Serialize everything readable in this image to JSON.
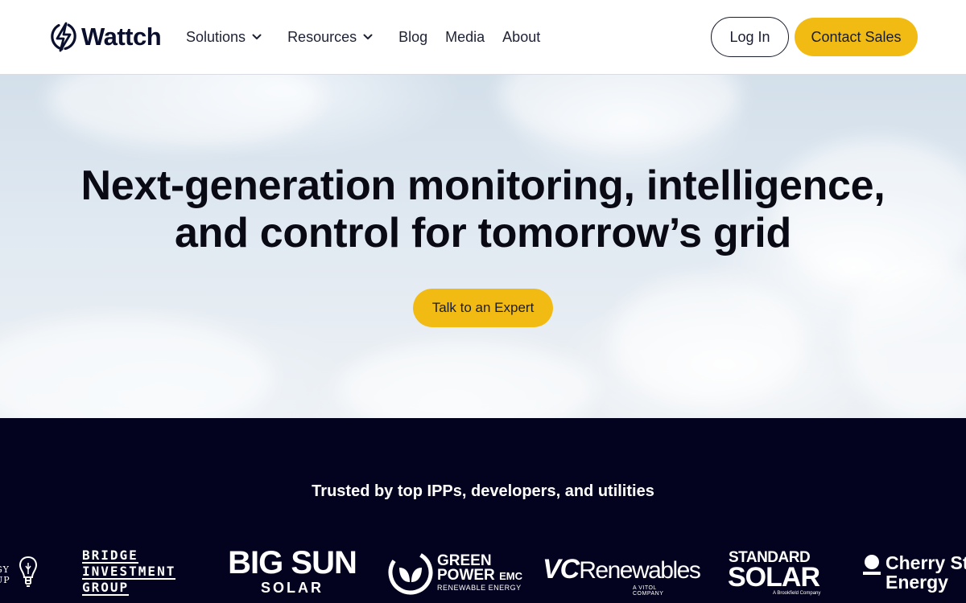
{
  "nav": {
    "brand": "Wattch",
    "items": [
      {
        "label": "Solutions",
        "has_dropdown": true
      },
      {
        "label": "Resources",
        "has_dropdown": true
      },
      {
        "label": "Blog"
      },
      {
        "label": "Media"
      },
      {
        "label": "About"
      }
    ],
    "login_label": "Log In",
    "contact_label": "Contact Sales"
  },
  "hero": {
    "title_line1": "Next-generation monitoring, intelligence,",
    "title_line2": "and control for tomorrow’s grid",
    "cta_label": "Talk to an Expert"
  },
  "trust": {
    "title": "Trusted by top IPPs, developers, and utilities",
    "logos": {
      "energy_group": {
        "line1": "GY",
        "line2": "UP"
      },
      "bridge": {
        "line1": "BRIDGE",
        "line2": "INVESTMENT",
        "line3": "GROUP"
      },
      "big_sun": {
        "line1": "BIG SUN",
        "line2": "SOLAR"
      },
      "green_power": {
        "line1": "GREEN",
        "line2": "POWER",
        "line2_suffix": "EMC",
        "line3": "RENEWABLE ENERGY"
      },
      "vc_renewables": {
        "prefix": "VC",
        "name": "Renewables",
        "tagline": "A VITOL COMPANY"
      },
      "standard_solar": {
        "line1": "STANDARD",
        "line2": "SOLAR",
        "tagline": "A Brookfield Company"
      },
      "cherry_street": {
        "line1": "Cherry St",
        "line2": "Energy"
      }
    }
  },
  "colors": {
    "accent": "#f2bb14",
    "navy": "#03031f",
    "brand_text": "#0b0f2e"
  },
  "icons": {
    "logo": "bolt-in-circle-icon",
    "dropdown": "chevron-down-icon"
  }
}
